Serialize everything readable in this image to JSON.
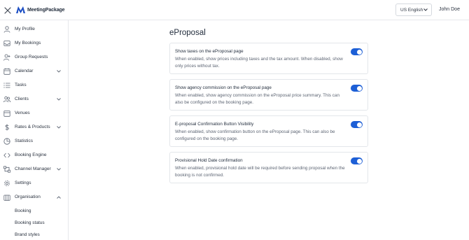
{
  "header": {
    "brand": "MeetingPackage",
    "language": "US English",
    "user_name": "John Doe"
  },
  "sidebar": {
    "items": [
      {
        "label": "My Profile",
        "icon": "user-icon"
      },
      {
        "label": "My Bookings",
        "icon": "inbox-icon"
      },
      {
        "label": "Group Requests",
        "icon": "user-plus-icon"
      },
      {
        "label": "Calendar",
        "icon": "calendar-icon"
      },
      {
        "label": "Tasks",
        "icon": "list-icon"
      },
      {
        "label": "Clients",
        "icon": "users-icon"
      },
      {
        "label": "Venues",
        "icon": "building-icon"
      },
      {
        "label": "Rates & Products",
        "icon": "dollar-icon"
      },
      {
        "label": "Statistics",
        "icon": "pie-chart-icon"
      },
      {
        "label": "Booking Engine",
        "icon": "code-icon"
      },
      {
        "label": "Channel Manager",
        "icon": "share-icon"
      },
      {
        "label": "Settings",
        "icon": "gear-icon"
      },
      {
        "label": "Organisation",
        "icon": "organisation-icon"
      }
    ],
    "sub_items": [
      "Booking",
      "Booking status",
      "Brand styles"
    ]
  },
  "main": {
    "title": "eProposal",
    "settings": [
      {
        "title": "Show taxes on the eProposal page",
        "description": "When enabled, show prices including taxes and the tax amount. When disabled, show only prices without tax.",
        "enabled": true
      },
      {
        "title": "Show agency commission on the eProposal page",
        "description": "When enabled, show agency commission on the eProposal price summary. This can also be configured on the booking page.",
        "enabled": true
      },
      {
        "title": "E-proposal Confirmation Button Visibility",
        "description": "When enabled, show confirmation button on the eProposal page. This can also be configured on the booking page.",
        "enabled": true
      },
      {
        "title": "Provisional Hold Date confirmation",
        "description": "When enabled, provisional hold date will be required before sending proposal when the booking is not confirmed.",
        "enabled": true
      }
    ]
  },
  "colors": {
    "accent": "#1d5fd6",
    "border": "#e3e6ea",
    "text": "#2b3340"
  }
}
